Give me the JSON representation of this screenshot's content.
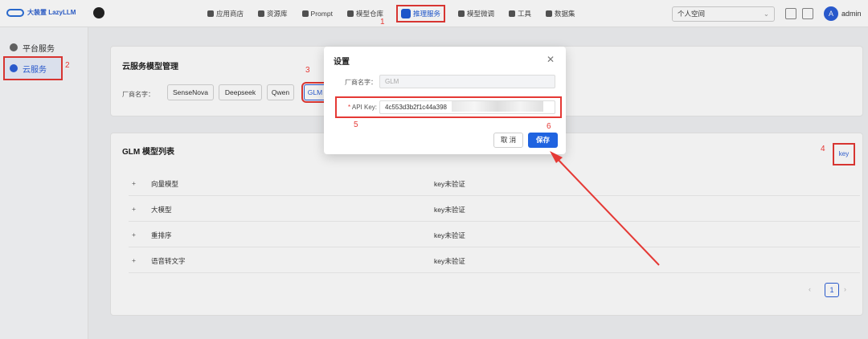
{
  "brand": {
    "name": "大装置 LazyLLM"
  },
  "nav": [
    {
      "label": "应用商店"
    },
    {
      "label": "资源库"
    },
    {
      "label": "Prompt"
    },
    {
      "label": "模型仓库"
    },
    {
      "label": "推理服务"
    },
    {
      "label": "模型微调"
    },
    {
      "label": "工具"
    },
    {
      "label": "数据集"
    }
  ],
  "workspace": {
    "value": "个人空间"
  },
  "user": {
    "avatar": "A",
    "name": "admin"
  },
  "sidebar": [
    {
      "label": "平台服务"
    },
    {
      "label": "云服务"
    }
  ],
  "cloud": {
    "title": "云服务模型管理",
    "vendor_label": "厂商名字：",
    "vendors": [
      "SenseNova",
      "Deepseek",
      "Qwen",
      "GLM"
    ]
  },
  "models": {
    "title": "GLM 模型列表",
    "key_button": "key",
    "rows": [
      {
        "name": "向量模型",
        "status": "key未验证"
      },
      {
        "name": "大模型",
        "status": "key未验证"
      },
      {
        "name": "重排序",
        "status": "key未验证"
      },
      {
        "name": "语音转文字",
        "status": "key未验证"
      }
    ],
    "page": "1"
  },
  "dialog": {
    "title": "设置",
    "vendor_label": "厂商名字：",
    "vendor_value": "GLM",
    "key_label": "API Key:",
    "key_required": "*",
    "key_value": "4c553d3b2f1c44a398",
    "cancel": "取 消",
    "save": "保存"
  },
  "annotations": [
    "1",
    "2",
    "3",
    "4",
    "5",
    "6"
  ],
  "colors": {
    "accent": "#2c5fd8",
    "annotation": "#e53935"
  }
}
